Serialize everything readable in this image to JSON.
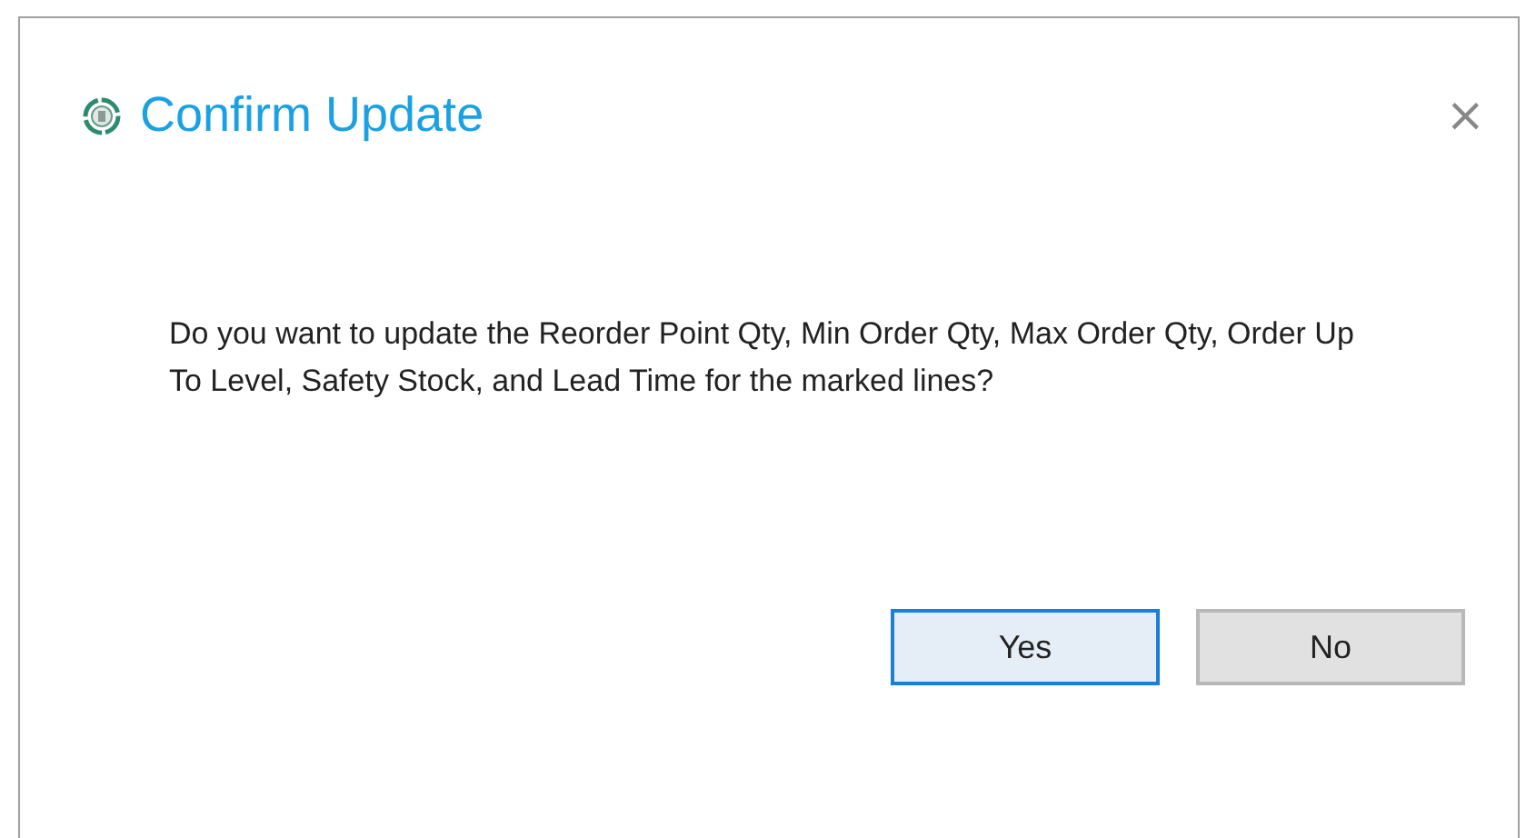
{
  "window": {
    "title": "Confirm Update",
    "close": "×"
  },
  "message": "Do you want to update the Reorder Point Qty, Min Order Qty, Max Order Qty, Order Up To Level, Safety Stock, and Lead Time for the marked lines?",
  "buttons": [
    {
      "label": "Yes",
      "focused": true
    },
    {
      "label": "No",
      "focused": false
    }
  ]
}
